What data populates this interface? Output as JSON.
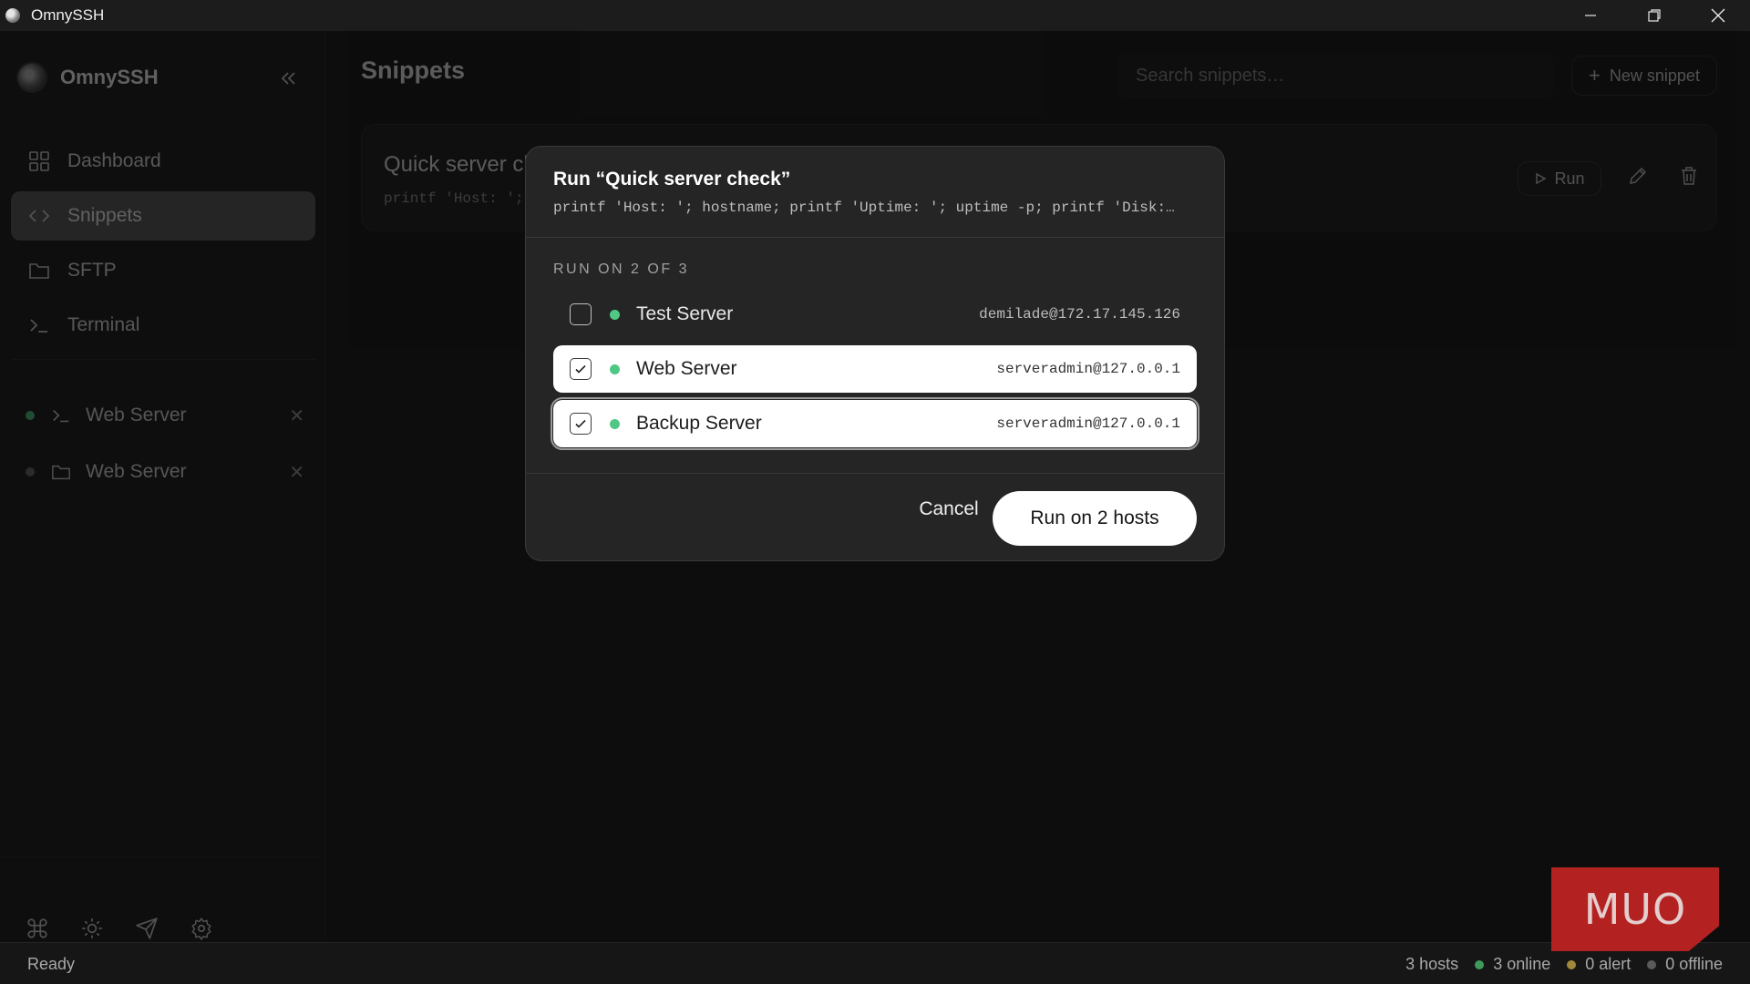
{
  "window": {
    "title": "OmnySSH"
  },
  "sidebar": {
    "brand": "OmnySSH",
    "nav": [
      {
        "label": "Dashboard",
        "icon": "grid-icon"
      },
      {
        "label": "Snippets",
        "icon": "code-icon",
        "active": true
      },
      {
        "label": "SFTP",
        "icon": "folder-icon"
      },
      {
        "label": "Terminal",
        "icon": "terminal-icon"
      }
    ],
    "sessions": [
      {
        "label": "Web Server",
        "type": "terminal",
        "status_color": "#4fc785"
      },
      {
        "label": "Web Server",
        "type": "sftp",
        "status_color": "#6a6a6a"
      }
    ],
    "tools": [
      "command-icon",
      "sun-icon",
      "send-icon",
      "gear-icon"
    ]
  },
  "main": {
    "title": "Snippets",
    "search_placeholder": "Search snippets…",
    "new_button": "New snippet",
    "snippet": {
      "name": "Quick server cl",
      "command": "printf 'Host: ';",
      "run_label": "Run"
    }
  },
  "modal": {
    "title": "Run “Quick server check”",
    "command": "printf 'Host: '; hostname; printf 'Uptime: '; uptime -p; printf 'Disk:…",
    "section_label": "RUN ON 2 OF 3",
    "hosts": [
      {
        "name": "Test Server",
        "address": "demilade@172.17.145.126",
        "checked": false,
        "status_color": "#4fc785"
      },
      {
        "name": "Web Server",
        "address": "serveradmin@127.0.0.1",
        "checked": true,
        "status_color": "#4fc785"
      },
      {
        "name": "Backup Server",
        "address": "serveradmin@127.0.0.1",
        "checked": true,
        "status_color": "#4fc785"
      }
    ],
    "cancel_label": "Cancel",
    "primary_label": "Run on 2 hosts"
  },
  "statusbar": {
    "status": "Ready",
    "hosts": "3 hosts",
    "online": "3 online",
    "alert": "0 alert",
    "offline": "0 offline",
    "colors": {
      "online": "#3f9a5a",
      "alert": "#a08a3a",
      "offline": "#5a5a5a"
    }
  },
  "watermark": "MUO"
}
